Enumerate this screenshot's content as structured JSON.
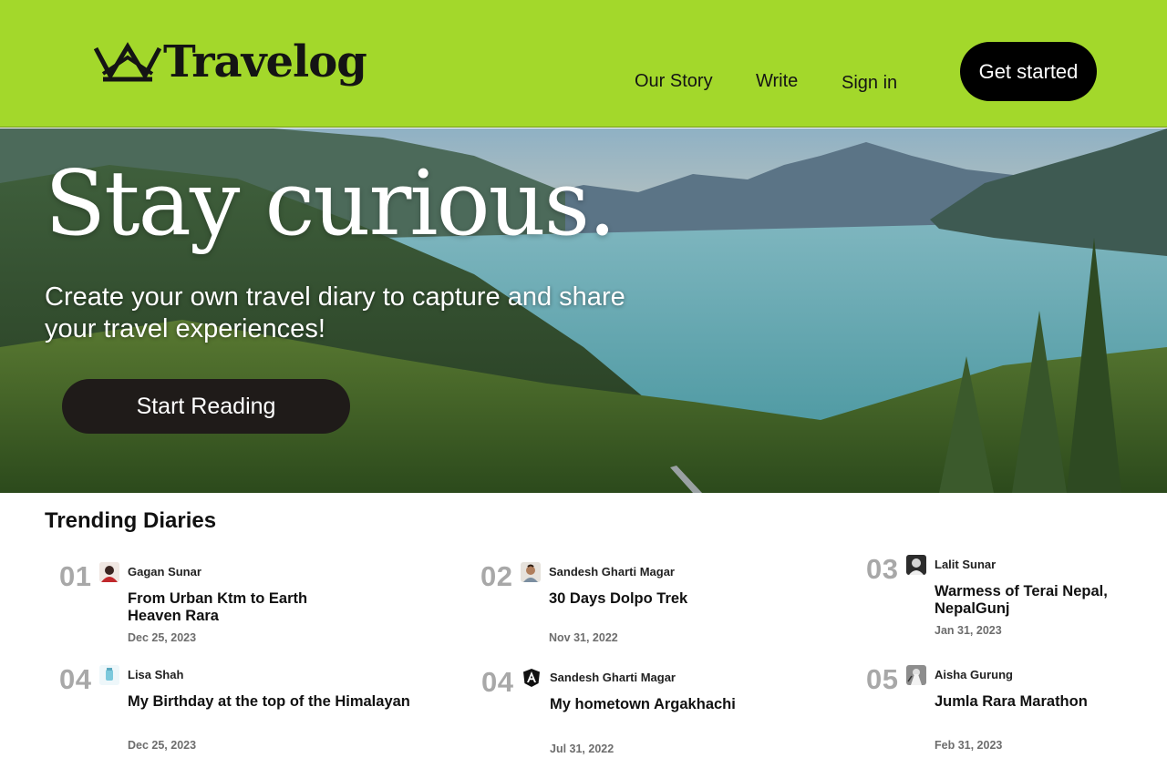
{
  "header": {
    "logo_text": "Travelog",
    "logo_icon": "crown-icon",
    "nav": [
      "Our Story",
      "Write",
      "Sign in"
    ],
    "cta": "Get started",
    "background_color": "#a3d82b"
  },
  "hero": {
    "title": "Stay curious.",
    "subtitle": "Create your own travel diary to capture and share your travel experiences!",
    "button": "Start Reading",
    "image": "lake-mountains-forest-landscape"
  },
  "trending": {
    "title": "Trending Diaries",
    "items": [
      {
        "num": "01",
        "author": "Gagan Sunar",
        "title": "From Urban Ktm to Earth Heaven Rara",
        "date": "Dec 25, 2023",
        "avatar": "person-photo-icon"
      },
      {
        "num": "02",
        "author": "Sandesh  Gharti Magar",
        "title": "30 Days Dolpo Trek",
        "date": "Nov 31, 2022",
        "avatar": "person-photo-icon"
      },
      {
        "num": "03",
        "author": "Lalit Sunar",
        "title": "Warmess of Terai Nepal, NepalGunj",
        "date": "Jan 31, 2023",
        "avatar": "person-photo-icon"
      },
      {
        "num": "04",
        "author": "Lisa Shah",
        "title": "My Birthday at the top of the Himalayan",
        "date": "Dec 25, 2023",
        "avatar": "cup-icon"
      },
      {
        "num": "04",
        "author": "Sandesh  Gharti Magar",
        "title": "My hometown Argakhachi",
        "date": "Jul 31, 2022",
        "avatar": "angular-icon"
      },
      {
        "num": "05",
        "author": "Aisha Gurung",
        "title": "Jumla Rara Marathon",
        "date": "Feb 31, 2023",
        "avatar": "person-photo-icon"
      }
    ]
  }
}
